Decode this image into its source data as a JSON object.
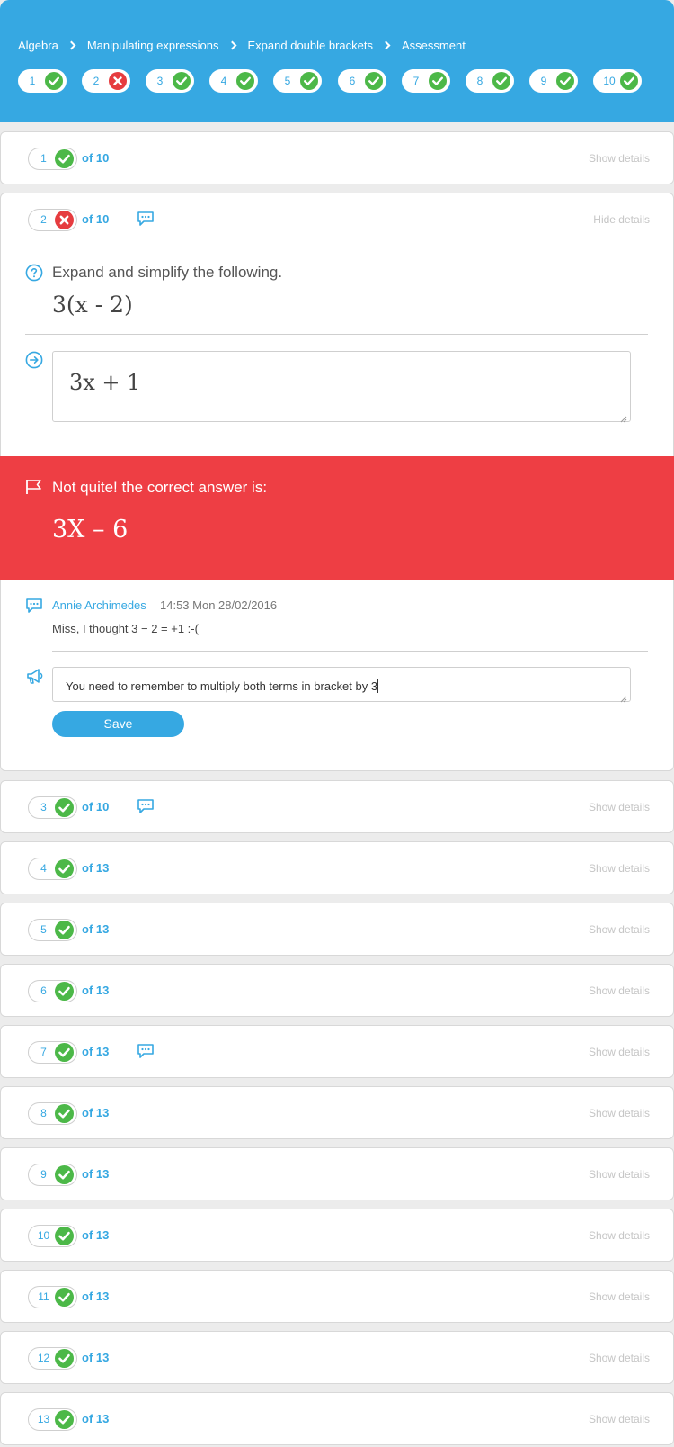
{
  "breadcrumb": [
    "Algebra",
    "Manipulating expressions",
    "Expand double brackets",
    "Assessment"
  ],
  "progress": [
    {
      "label": "1",
      "status": "correct"
    },
    {
      "label": "2",
      "status": "incorrect"
    },
    {
      "label": "3",
      "status": "correct"
    },
    {
      "label": "4",
      "status": "correct"
    },
    {
      "label": "5",
      "status": "correct"
    },
    {
      "label": "6",
      "status": "correct"
    },
    {
      "label": "7",
      "status": "correct"
    },
    {
      "label": "8",
      "status": "correct"
    },
    {
      "label": "9",
      "status": "correct"
    },
    {
      "label": "10",
      "status": "correct"
    }
  ],
  "questions": [
    {
      "number": "1",
      "total": "of 10",
      "status": "correct",
      "toggle": "Show details",
      "has_comment": false
    },
    {
      "number": "2",
      "total": "of 10",
      "status": "incorrect",
      "toggle": "Hide details",
      "has_comment": true
    },
    {
      "number": "3",
      "total": "of 10",
      "status": "correct",
      "toggle": "Show details",
      "has_comment": true
    },
    {
      "number": "4",
      "total": "of 13",
      "status": "correct",
      "toggle": "Show details",
      "has_comment": false
    },
    {
      "number": "5",
      "total": "of 13",
      "status": "correct",
      "toggle": "Show details",
      "has_comment": false
    },
    {
      "number": "6",
      "total": "of 13",
      "status": "correct",
      "toggle": "Show details",
      "has_comment": false
    },
    {
      "number": "7",
      "total": "of 13",
      "status": "correct",
      "toggle": "Show details",
      "has_comment": true
    },
    {
      "number": "8",
      "total": "of 13",
      "status": "correct",
      "toggle": "Show details",
      "has_comment": false
    },
    {
      "number": "9",
      "total": "of 13",
      "status": "correct",
      "toggle": "Show details",
      "has_comment": false
    },
    {
      "number": "10",
      "total": "of 13",
      "status": "correct",
      "toggle": "Show details",
      "has_comment": false
    },
    {
      "number": "11",
      "total": "of 13",
      "status": "correct",
      "toggle": "Show details",
      "has_comment": false
    },
    {
      "number": "12",
      "total": "of 13",
      "status": "correct",
      "toggle": "Show details",
      "has_comment": false
    },
    {
      "number": "13",
      "total": "of 13",
      "status": "correct",
      "toggle": "Show details",
      "has_comment": false
    }
  ],
  "expanded": {
    "prompt": "Expand and simplify the following.",
    "expression": "3(x - 2)",
    "student_answer": "3x + 1",
    "feedback_message": "Not quite! the correct answer is:",
    "correct_answer": "3X – 6",
    "comment": {
      "author": "Annie Archimedes",
      "time": "14:53 Mon 28/02/2016",
      "text": "Miss, I thought 3 − 2 = +1 :-("
    },
    "reply_value": "You  need to remember to multiply both terms in bracket by 3",
    "save_label": "Save"
  },
  "colors": {
    "accent": "#36a8e2",
    "correct": "#4cb848",
    "incorrect": "#e63c3f",
    "feedback_bg": "#ee3e44"
  }
}
